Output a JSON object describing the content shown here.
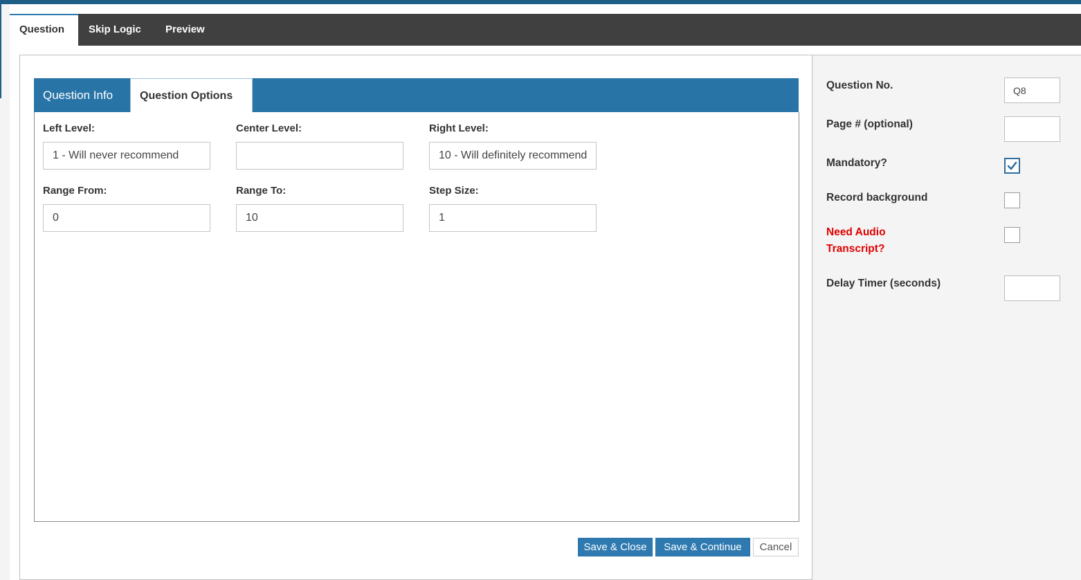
{
  "top_tabs": [
    {
      "label": "Question",
      "active": true
    },
    {
      "label": "Skip Logic",
      "active": false
    },
    {
      "label": "Preview",
      "active": false
    }
  ],
  "sub_tabs": [
    {
      "label": "Question Info",
      "active": false
    },
    {
      "label": "Question Options",
      "active": true
    }
  ],
  "options": {
    "left_level": {
      "label": "Left Level:",
      "value": "1 - Will never recommend"
    },
    "center_level": {
      "label": "Center Level:",
      "value": ""
    },
    "right_level": {
      "label": "Right Level:",
      "value": "10 - Will definitely recommend"
    },
    "range_from": {
      "label": "Range From:",
      "value": "0"
    },
    "range_to": {
      "label": "Range To:",
      "value": "10"
    },
    "step_size": {
      "label": "Step Size:",
      "value": "1"
    }
  },
  "buttons": {
    "save_close": "Save & Close",
    "save_continue": "Save & Continue",
    "cancel": "Cancel"
  },
  "settings": {
    "question_no": {
      "label": "Question No.",
      "value": "Q8"
    },
    "page_number": {
      "label": "Page # (optional)",
      "value": ""
    },
    "mandatory": {
      "label": "Mandatory?",
      "checked": true
    },
    "record_background": {
      "label": "Record background",
      "checked": false
    },
    "need_audio_transcript": {
      "label_line1": "Need Audio",
      "label_line2": "Transcript?",
      "checked": false,
      "color": "#e00000"
    },
    "delay_timer": {
      "label": "Delay Timer (seconds)",
      "value": ""
    }
  },
  "colors": {
    "accent": "#2874a6",
    "tabbar": "#404040",
    "topbar": "#1d5f86",
    "warning": "#e00000"
  }
}
